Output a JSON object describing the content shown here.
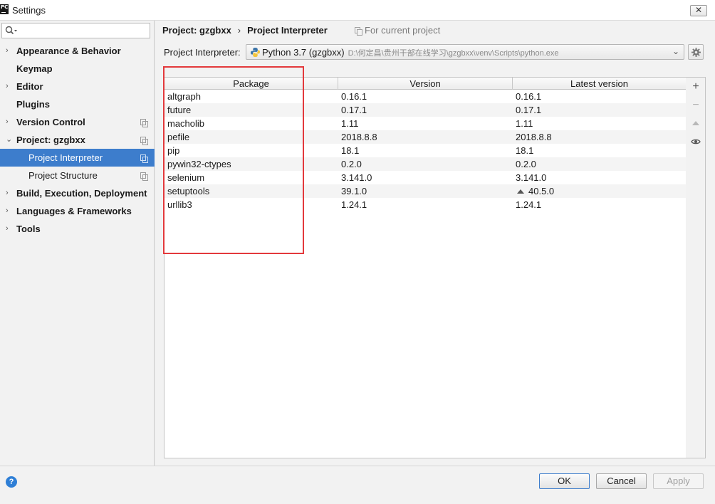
{
  "window": {
    "title": "Settings",
    "app_icon_text": "PC",
    "close_glyph": "✕"
  },
  "sidebar": {
    "search_placeholder": "",
    "items": [
      {
        "label": "Appearance & Behavior",
        "arrow": "›"
      },
      {
        "label": "Keymap",
        "arrow": ""
      },
      {
        "label": "Editor",
        "arrow": "›"
      },
      {
        "label": "Plugins",
        "arrow": ""
      },
      {
        "label": "Version Control",
        "arrow": "›"
      },
      {
        "label": "Project: gzgbxx",
        "arrow": "⌄"
      },
      {
        "label": "Project Interpreter",
        "arrow": ""
      },
      {
        "label": "Project Structure",
        "arrow": ""
      },
      {
        "label": "Build, Execution, Deployment",
        "arrow": "›"
      },
      {
        "label": "Languages & Frameworks",
        "arrow": "›"
      },
      {
        "label": "Tools",
        "arrow": "›"
      }
    ],
    "selected": "Project Interpreter"
  },
  "breadcrumb": {
    "project": "Project: gzgbxx",
    "separator": "›",
    "page": "Project Interpreter",
    "scope": "For current project"
  },
  "interpreter": {
    "label": "Project Interpreter:",
    "name": "Python 3.7 (gzgbxx)",
    "path": "D:\\何定昌\\贵州干部在线学习\\gzgbxx\\venv\\Scripts\\python.exe"
  },
  "table": {
    "columns": [
      "Package",
      "Version",
      "Latest version"
    ],
    "rows": [
      {
        "package": "altgraph",
        "version": "0.16.1",
        "latest": "0.16.1",
        "upgrade": false
      },
      {
        "package": "future",
        "version": "0.17.1",
        "latest": "0.17.1",
        "upgrade": false
      },
      {
        "package": "macholib",
        "version": "1.11",
        "latest": "1.11",
        "upgrade": false
      },
      {
        "package": "pefile",
        "version": "2018.8.8",
        "latest": "2018.8.8",
        "upgrade": false
      },
      {
        "package": "pip",
        "version": "18.1",
        "latest": "18.1",
        "upgrade": false
      },
      {
        "package": "pywin32-ctypes",
        "version": "0.2.0",
        "latest": "0.2.0",
        "upgrade": false
      },
      {
        "package": "selenium",
        "version": "3.141.0",
        "latest": "3.141.0",
        "upgrade": false
      },
      {
        "package": "setuptools",
        "version": "39.1.0",
        "latest": "40.5.0",
        "upgrade": true
      },
      {
        "package": "urllib3",
        "version": "1.24.1",
        "latest": "1.24.1",
        "upgrade": false
      }
    ]
  },
  "tools": {
    "add": "+",
    "remove": "−"
  },
  "buttons": {
    "ok": "OK",
    "cancel": "Cancel",
    "apply": "Apply",
    "help": "?"
  },
  "colors": {
    "accent": "#3d7dcc",
    "highlight_box": "#e3393c"
  }
}
